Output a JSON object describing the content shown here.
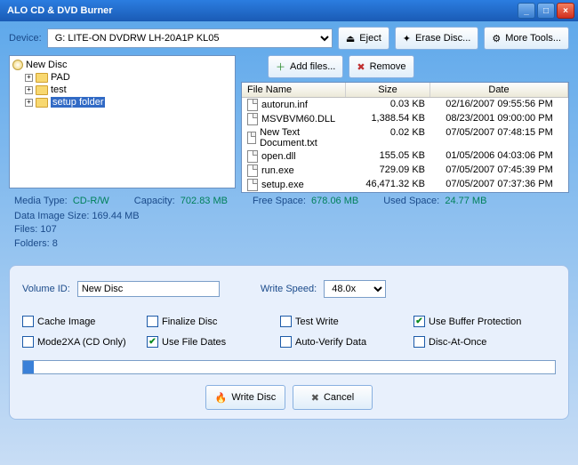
{
  "title": "ALO CD & DVD Burner",
  "device_label": "Device:",
  "device_selected": "G: LITE-ON DVDRW LH-20A1P KL05",
  "buttons": {
    "eject": "Eject",
    "erase": "Erase Disc...",
    "more": "More Tools...",
    "add": "Add files...",
    "remove": "Remove",
    "write": "Write Disc",
    "cancel": "Cancel"
  },
  "tree": {
    "root": "New Disc",
    "items": [
      "PAD",
      "test",
      "setup folder"
    ]
  },
  "columns": {
    "name": "File Name",
    "size": "Size",
    "date": "Date"
  },
  "files": [
    {
      "name": "autorun.inf",
      "size": "0.03 KB",
      "date": "02/16/2007 09:55:56 PM"
    },
    {
      "name": "MSVBVM60.DLL",
      "size": "1,388.54 KB",
      "date": "08/23/2001 09:00:00 PM"
    },
    {
      "name": "New Text Document.txt",
      "size": "0.02 KB",
      "date": "07/05/2007 07:48:15 PM"
    },
    {
      "name": "open.dll",
      "size": "155.05 KB",
      "date": "01/05/2006 04:03:06 PM"
    },
    {
      "name": "run.exe",
      "size": "729.09 KB",
      "date": "07/05/2007 07:45:39 PM"
    },
    {
      "name": "setup.exe",
      "size": "46,471.32 KB",
      "date": "07/05/2007 07:37:36 PM"
    }
  ],
  "stats": {
    "media_type_lbl": "Media Type:",
    "media_type": "CD-R/W",
    "capacity_lbl": "Capacity:",
    "capacity": "702.83 MB",
    "free_lbl": "Free Space:",
    "free": "678.06 MB",
    "used_lbl": "Used Space:",
    "used": "24.77 MB",
    "image_size": "Data Image Size: 169.44 MB",
    "files_count": "Files: 107",
    "folders_count": "Folders: 8"
  },
  "fields": {
    "volume_lbl": "Volume ID:",
    "volume_val": "New Disc",
    "speed_lbl": "Write Speed:",
    "speed_val": "48.0x"
  },
  "checks": {
    "cache": "Cache Image",
    "finalize": "Finalize Disc",
    "test": "Test Write",
    "buffer": "Use Buffer Protection",
    "mode2xa": "Mode2XA (CD Only)",
    "filedates": "Use File Dates",
    "autoverify": "Auto-Verify Data",
    "dao": "Disc-At-Once"
  }
}
